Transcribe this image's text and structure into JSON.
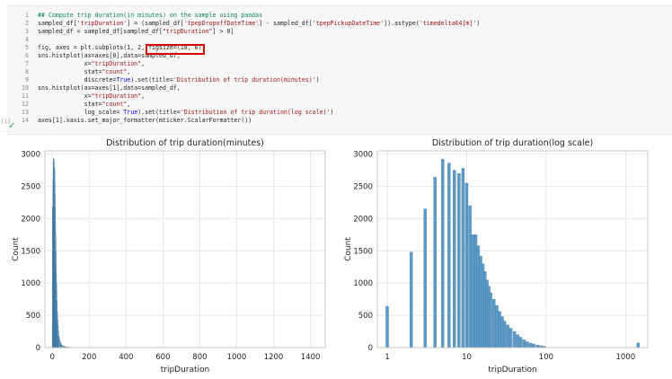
{
  "cell": {
    "lines": [
      {
        "n": "1",
        "segments": [
          {
            "t": "## Compute trip duration(in minutes) on the sample using pandas",
            "c": "cm"
          }
        ]
      },
      {
        "n": "2",
        "segments": [
          {
            "t": "sampled_df[",
            "c": ""
          },
          {
            "t": "'tripDuration'",
            "c": "st"
          },
          {
            "t": "] = (sampled_df[",
            "c": ""
          },
          {
            "t": "'tpepDropoffDateTime'",
            "c": "st"
          },
          {
            "t": "] - sampled_df[",
            "c": ""
          },
          {
            "t": "'tpepPickupDateTime'",
            "c": "st"
          },
          {
            "t": "]).astype(",
            "c": ""
          },
          {
            "t": "'timedelta64[m]'",
            "c": "st"
          },
          {
            "t": ")",
            "c": ""
          }
        ]
      },
      {
        "n": "3",
        "segments": [
          {
            "t": "sampled_df = sampled_df[sampled_df[",
            "c": ""
          },
          {
            "t": "\"tripDuration\"",
            "c": "st"
          },
          {
            "t": "] > 0]",
            "c": ""
          }
        ]
      },
      {
        "n": "4",
        "segments": [
          {
            "t": "",
            "c": ""
          }
        ]
      },
      {
        "n": "5",
        "segments": [
          {
            "t": "fig, axes = plt.subplots(1, 2, figsize=(18, 6))",
            "c": ""
          }
        ]
      },
      {
        "n": "6",
        "segments": [
          {
            "t": "sns.histplot(ax=axes[0],data=sampled_df,",
            "c": ""
          }
        ]
      },
      {
        "n": "7",
        "segments": [
          {
            "t": "             x=",
            "c": ""
          },
          {
            "t": "\"tripDuration\"",
            "c": "st"
          },
          {
            "t": ",",
            "c": ""
          }
        ]
      },
      {
        "n": "8",
        "segments": [
          {
            "t": "             stat=",
            "c": ""
          },
          {
            "t": "\"count\"",
            "c": "st"
          },
          {
            "t": ",",
            "c": ""
          }
        ]
      },
      {
        "n": "9",
        "segments": [
          {
            "t": "             discrete=",
            "c": ""
          },
          {
            "t": "True",
            "c": "kw"
          },
          {
            "t": ").set(title=",
            "c": ""
          },
          {
            "t": "'Distribution of trip duration(minutes)'",
            "c": "st"
          },
          {
            "t": ")",
            "c": ""
          }
        ]
      },
      {
        "n": "10",
        "segments": [
          {
            "t": "sns.histplot(ax=axes[1],data=sampled_df,",
            "c": ""
          }
        ]
      },
      {
        "n": "11",
        "segments": [
          {
            "t": "             x=",
            "c": ""
          },
          {
            "t": "\"tripDuration\"",
            "c": "st"
          },
          {
            "t": ",",
            "c": ""
          }
        ]
      },
      {
        "n": "12",
        "segments": [
          {
            "t": "             stat=",
            "c": ""
          },
          {
            "t": "\"count\"",
            "c": "st"
          },
          {
            "t": ",",
            "c": ""
          }
        ]
      },
      {
        "n": "13",
        "segments": [
          {
            "t": "             log_scale= ",
            "c": ""
          },
          {
            "t": "True",
            "c": "kw"
          },
          {
            "t": ").set(title=",
            "c": ""
          },
          {
            "t": "'Distribution of trip duration(log scale)'",
            "c": "st"
          },
          {
            "t": ")",
            "c": ""
          }
        ]
      },
      {
        "n": "14",
        "segments": [
          {
            "t": "axes[1].xaxis.set_major_formatter(mticker.ScalarFormatter())",
            "c": ""
          }
        ]
      }
    ],
    "gutter_marks": [
      "[1]",
      "..."
    ],
    "status_icon": "check-icon",
    "status_color": "#2da44e",
    "highlight_color": "#d40000"
  },
  "chart_data": [
    {
      "type": "bar",
      "title": "Distribution of trip duration(minutes)",
      "xlabel": "tripDuration",
      "ylabel": "Count",
      "xlim": [
        -40,
        1480
      ],
      "ylim": [
        0,
        3050
      ],
      "xticks": [
        "0",
        "200",
        "400",
        "600",
        "800",
        "1000",
        "1200",
        "1400"
      ],
      "yticks": [
        "0",
        "500",
        "1000",
        "1500",
        "2000",
        "2500",
        "3000"
      ],
      "grid": true,
      "bar_color": "#5a9bc9",
      "bins": [
        {
          "x": 1,
          "y": 2180
        },
        {
          "x": 2,
          "y": 1480
        },
        {
          "x": 3,
          "y": 2150
        },
        {
          "x": 4,
          "y": 2600
        },
        {
          "x": 5,
          "y": 2930
        },
        {
          "x": 6,
          "y": 2870
        },
        {
          "x": 7,
          "y": 2760
        },
        {
          "x": 8,
          "y": 2700
        },
        {
          "x": 9,
          "y": 2780
        },
        {
          "x": 10,
          "y": 2550
        },
        {
          "x": 11,
          "y": 2380
        },
        {
          "x": 12,
          "y": 2180
        },
        {
          "x": 13,
          "y": 1950
        },
        {
          "x": 14,
          "y": 1780
        },
        {
          "x": 15,
          "y": 1620
        },
        {
          "x": 16,
          "y": 1480
        },
        {
          "x": 17,
          "y": 1300
        },
        {
          "x": 18,
          "y": 1150
        },
        {
          "x": 19,
          "y": 1000
        },
        {
          "x": 20,
          "y": 880
        },
        {
          "x": 22,
          "y": 720
        },
        {
          "x": 24,
          "y": 560
        },
        {
          "x": 26,
          "y": 430
        },
        {
          "x": 28,
          "y": 330
        },
        {
          "x": 30,
          "y": 250
        },
        {
          "x": 33,
          "y": 180
        },
        {
          "x": 36,
          "y": 130
        },
        {
          "x": 40,
          "y": 90
        },
        {
          "x": 45,
          "y": 60
        },
        {
          "x": 50,
          "y": 40
        },
        {
          "x": 60,
          "y": 25
        },
        {
          "x": 70,
          "y": 15
        },
        {
          "x": 80,
          "y": 10
        },
        {
          "x": 90,
          "y": 6
        }
      ]
    },
    {
      "type": "bar",
      "title": "Distribution of trip duration(log scale)",
      "xlabel": "tripDuration",
      "ylabel": "Count",
      "xscale": "log",
      "xlim": [
        0.75,
        1900
      ],
      "ylim": [
        0,
        3050
      ],
      "xticks": [
        "1",
        "10",
        "100",
        "1000"
      ],
      "yticks": [
        "0",
        "500",
        "1000",
        "1500",
        "2000",
        "2500",
        "3000"
      ],
      "grid": true,
      "bar_color": "#5a9bc9",
      "bins": [
        {
          "x": 1,
          "y": 640
        },
        {
          "x": 2,
          "y": 1480
        },
        {
          "x": 3,
          "y": 2150
        },
        {
          "x": 4,
          "y": 2640
        },
        {
          "x": 5,
          "y": 2920
        },
        {
          "x": 6,
          "y": 2860
        },
        {
          "x": 7,
          "y": 2750
        },
        {
          "x": 8,
          "y": 2700
        },
        {
          "x": 9,
          "y": 2780
        },
        {
          "x": 10,
          "y": 2550
        },
        {
          "x": 11,
          "y": 2200
        },
        {
          "x": 12,
          "y": 1750
        },
        {
          "x": 13,
          "y": 1750
        },
        {
          "x": 14,
          "y": 1580
        },
        {
          "x": 15,
          "y": 1420
        },
        {
          "x": 16,
          "y": 1300
        },
        {
          "x": 17,
          "y": 1180
        },
        {
          "x": 18,
          "y": 1050
        },
        {
          "x": 19,
          "y": 950
        },
        {
          "x": 20,
          "y": 850
        },
        {
          "x": 22,
          "y": 750
        },
        {
          "x": 24,
          "y": 650
        },
        {
          "x": 26,
          "y": 560
        },
        {
          "x": 28,
          "y": 480
        },
        {
          "x": 30,
          "y": 410
        },
        {
          "x": 33,
          "y": 350
        },
        {
          "x": 36,
          "y": 300
        },
        {
          "x": 40,
          "y": 250
        },
        {
          "x": 44,
          "y": 200
        },
        {
          "x": 48,
          "y": 160
        },
        {
          "x": 53,
          "y": 120
        },
        {
          "x": 58,
          "y": 90
        },
        {
          "x": 64,
          "y": 70
        },
        {
          "x": 70,
          "y": 55
        },
        {
          "x": 78,
          "y": 40
        },
        {
          "x": 86,
          "y": 30
        },
        {
          "x": 95,
          "y": 20
        },
        {
          "x": 1440,
          "y": 70
        }
      ]
    }
  ]
}
